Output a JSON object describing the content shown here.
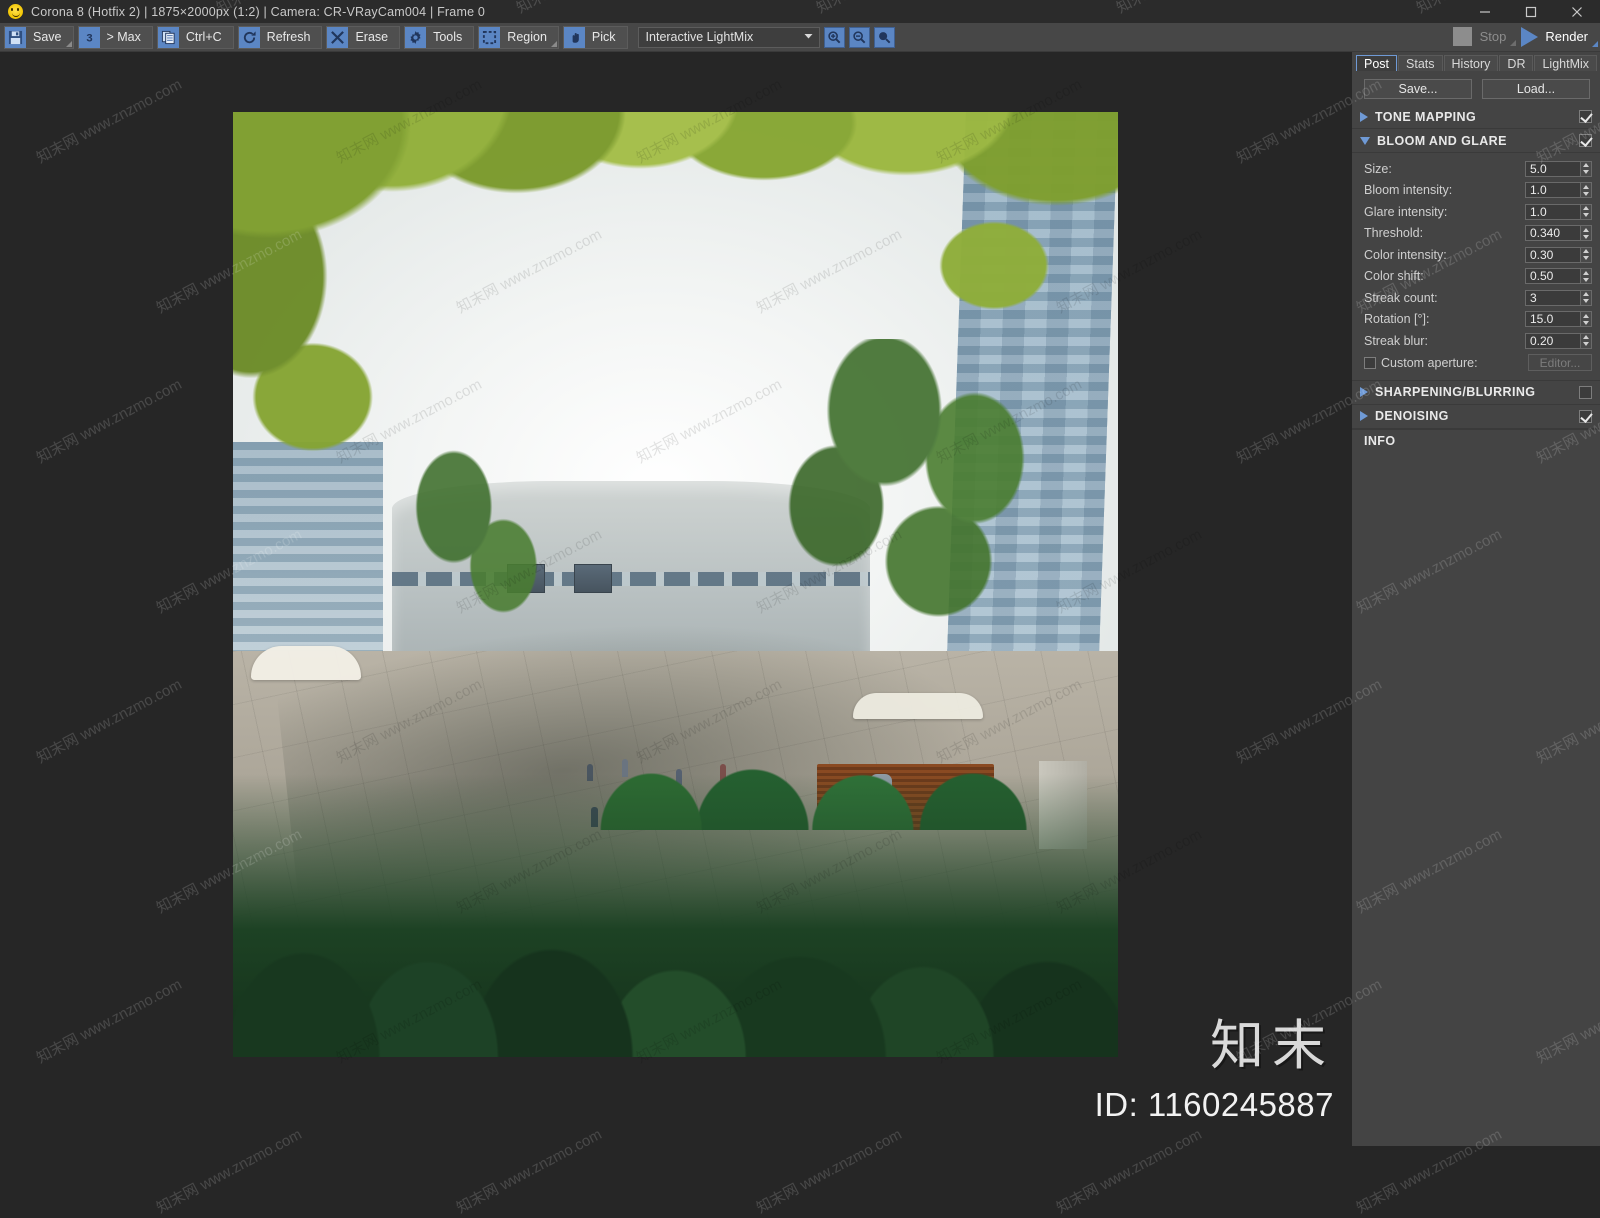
{
  "window": {
    "title": "Corona 8 (Hotfix 2) | 1875×2000px (1:2) | Camera: CR-VRayCam004 | Frame 0",
    "app_icon": "smiley-icon",
    "minimize": "–",
    "maximize": "□",
    "close": "×"
  },
  "toolbar": {
    "buttons": [
      {
        "label": "Save",
        "icon": "floppy-disk-icon",
        "dropdown": true
      },
      {
        "label": "> Max",
        "icon": "max-3-icon",
        "dropdown": false
      },
      {
        "label": "Ctrl+C",
        "icon": "copy-icon",
        "dropdown": false
      },
      {
        "label": "Refresh",
        "icon": "refresh-icon",
        "dropdown": false
      },
      {
        "label": "Erase",
        "icon": "x-cross-icon",
        "dropdown": false
      },
      {
        "label": "Tools",
        "icon": "gear-icon",
        "dropdown": false
      },
      {
        "label": "Region",
        "icon": "dashed-region-icon",
        "dropdown": true
      },
      {
        "label": "Pick",
        "icon": "hand-pointer-icon",
        "dropdown": false
      }
    ],
    "lightmix_select": {
      "value": "Interactive LightMix",
      "options": [
        "Interactive LightMix"
      ],
      "caret": "chevron-down-icon"
    },
    "zoom_buttons": [
      "zoom-in-icon",
      "zoom-out-icon",
      "zoom-reset-icon"
    ],
    "stop_label": "Stop",
    "render_label": "Render"
  },
  "panel": {
    "tabs": [
      {
        "label": "Post",
        "active": true
      },
      {
        "label": "Stats",
        "active": false
      },
      {
        "label": "History",
        "active": false
      },
      {
        "label": "DR",
        "active": false
      },
      {
        "label": "LightMix",
        "active": false
      }
    ],
    "save_label": "Save...",
    "load_label": "Load...",
    "sections": [
      {
        "title": "TONE MAPPING",
        "expanded": false,
        "checked": true
      },
      {
        "title": "BLOOM AND GLARE",
        "expanded": true,
        "checked": true
      },
      {
        "title": "SHARPENING/BLURRING",
        "expanded": false,
        "checked": false
      },
      {
        "title": "DENOISING",
        "expanded": false,
        "checked": true
      }
    ],
    "bloom_and_glare": {
      "params": [
        {
          "label": "Size:",
          "value": "5.0"
        },
        {
          "label": "Bloom intensity:",
          "value": "1.0"
        },
        {
          "label": "Glare intensity:",
          "value": "1.0"
        },
        {
          "label": "Threshold:",
          "value": "0.340"
        },
        {
          "label": "Color intensity:",
          "value": "0.30"
        },
        {
          "label": "Color shift:",
          "value": "0.50"
        },
        {
          "label": "Streak count:",
          "value": "3"
        },
        {
          "label": "Rotation [°]:",
          "value": "15.0"
        },
        {
          "label": "Streak blur:",
          "value": "0.20"
        }
      ],
      "custom_aperture": {
        "label": "Custom aperture:",
        "checked": false,
        "button_label": "Editor..."
      }
    },
    "info_title": "INFO"
  },
  "watermark": {
    "brand": "知末",
    "id_text": "ID: 1160245887",
    "tile_text": "知末网 www.znzmo.com"
  },
  "colors": {
    "accent_blue": "#5b86c4",
    "panel_bg": "#444444",
    "toolbar_bg": "#474747",
    "titlebar_bg": "#2b2b2b",
    "canvas_bg": "#262626",
    "text": "#e6e6e6"
  }
}
